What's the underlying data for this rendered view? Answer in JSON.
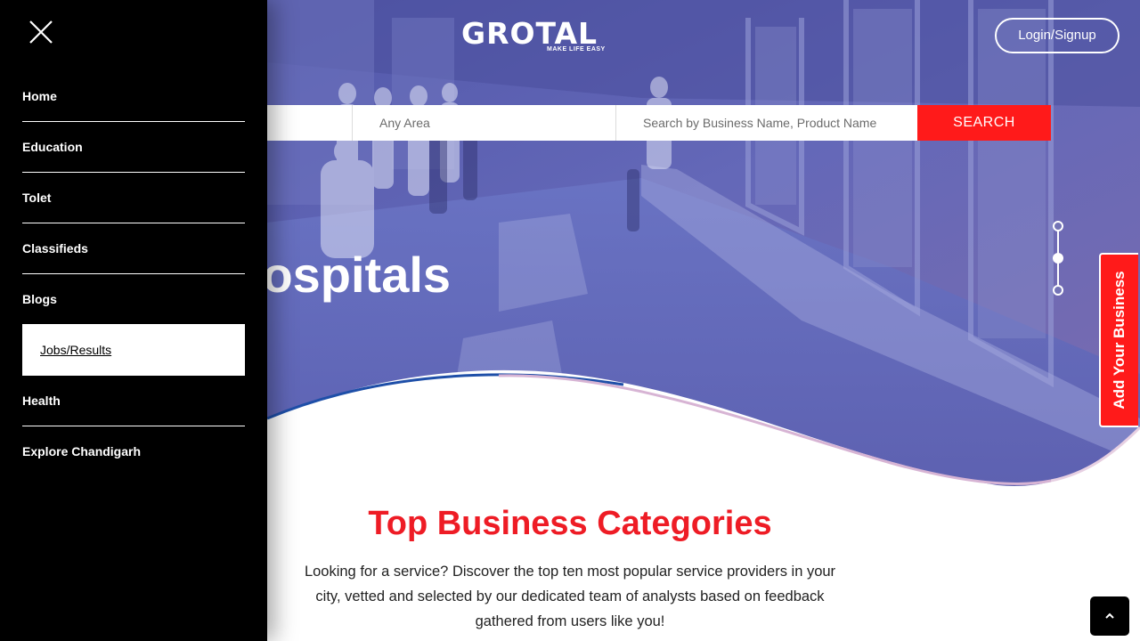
{
  "colors": {
    "hero_overlay": "#5b5fae",
    "accent_red": "#ee1c25",
    "button_red": "#ff1a1a",
    "sidebar_bg": "#000000"
  },
  "header": {
    "logo_text": "GROTAL",
    "logo_tagline": "MAKE LIFE EASY",
    "login_label": "Login/Signup"
  },
  "search": {
    "area_placeholder": "Any Area",
    "name_placeholder": "Search by Business Name, Product Name",
    "button_label": "SEARCH"
  },
  "hero": {
    "title": "Hospitals",
    "slider_active_index": 1,
    "slider_count": 3
  },
  "side_tab": {
    "label": "Add Your Business"
  },
  "sidebar": {
    "close_icon": "close-icon",
    "items": [
      {
        "label": "Home"
      },
      {
        "label": "Education"
      },
      {
        "label": "Tolet"
      },
      {
        "label": "Classifieds"
      },
      {
        "label": "Blogs"
      },
      {
        "label": "Jobs/Results",
        "active": true
      },
      {
        "label": "Health"
      },
      {
        "label": "Explore Chandigarh"
      }
    ]
  },
  "content": {
    "title": "Top Business Categories",
    "description": "Looking for a service? Discover the top ten most popular service providers in your city, vetted and selected by our dedicated team of analysts based on feedback gathered from users like you!"
  },
  "scroll_top_icon": "chevron-up-icon"
}
